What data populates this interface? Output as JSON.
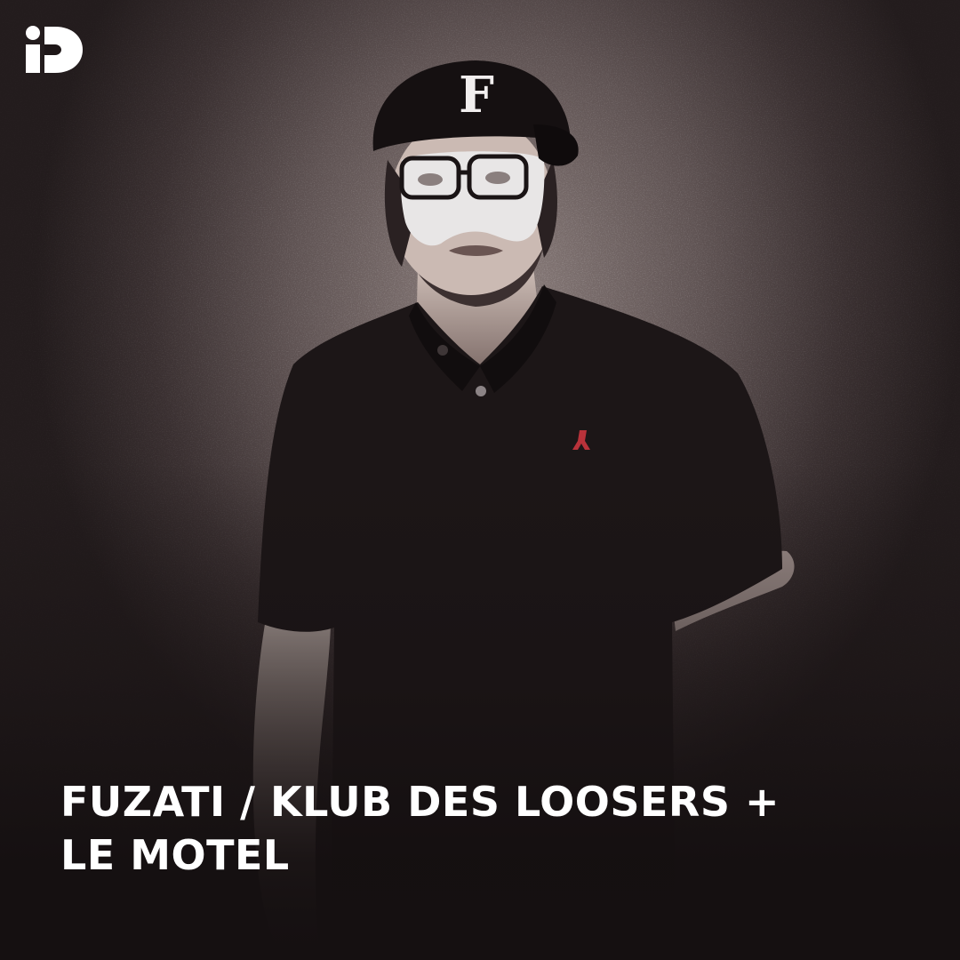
{
  "brand": {
    "logo_icon": "id-logo-icon",
    "logo_color": "#ffffff"
  },
  "title": {
    "line1": "FUZATI / KLUB DES LOOSERS +",
    "line2": "LE MOTEL"
  },
  "photo": {
    "subject_icon": "masked-person-photo",
    "cap_letter": "F",
    "colors": {
      "shirt": "#1c1617",
      "background": "#5f5353",
      "mask": "#e8e6e6",
      "logo_accent": "#b8323a"
    }
  }
}
